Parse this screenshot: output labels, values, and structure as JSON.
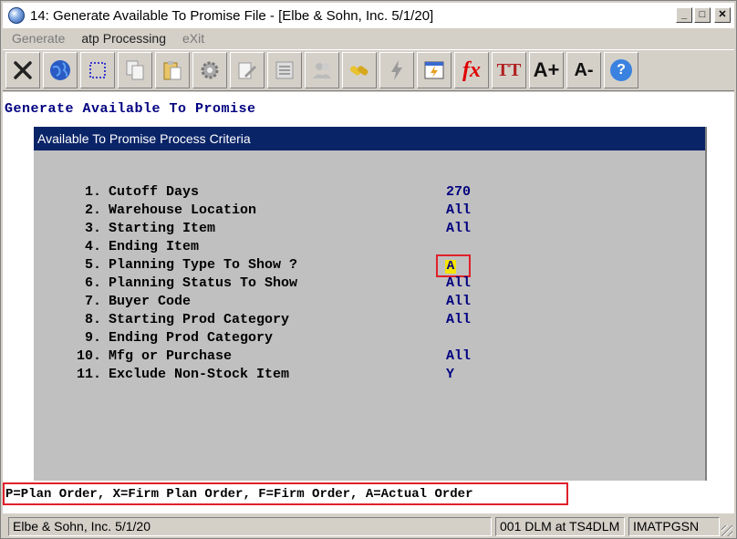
{
  "window": {
    "title": "14: Generate Available To Promise File - [Elbe & Sohn, Inc. 5/1/20]",
    "controls": [
      "_",
      "□",
      "✕"
    ]
  },
  "menu": [
    "Generate",
    "atp Processing",
    "eXit"
  ],
  "toolbar": [
    {
      "icon": "close-x-icon"
    },
    {
      "icon": "globe-icon"
    },
    {
      "icon": "select-box-icon"
    },
    {
      "icon": "copy-icon"
    },
    {
      "icon": "paste-icon"
    },
    {
      "icon": "gear-icon"
    },
    {
      "icon": "edit-icon"
    },
    {
      "icon": "list-icon"
    },
    {
      "icon": "users-icon"
    },
    {
      "icon": "link-icon"
    },
    {
      "icon": "lightning-icon"
    },
    {
      "icon": "calendar-icon"
    },
    {
      "icon": "function-icon",
      "text": "fx"
    },
    {
      "icon": "font-size-icon",
      "text": "TT"
    },
    {
      "icon": "font-increase-icon",
      "text": "A+"
    },
    {
      "icon": "font-decrease-icon",
      "text": "A-"
    },
    {
      "icon": "help-icon",
      "text": "?"
    }
  ],
  "page": {
    "heading": "Generate Available To Promise",
    "panel_title": "Available To Promise Process Criteria",
    "criteria": [
      {
        "num": "1.",
        "label": "Cutoff Days",
        "value": "270"
      },
      {
        "num": "2.",
        "label": "Warehouse Location",
        "value": "All"
      },
      {
        "num": "3.",
        "label": "Starting Item",
        "value": "All"
      },
      {
        "num": "4.",
        "label": "Ending Item",
        "value": ""
      },
      {
        "num": "5.",
        "label": "Planning Type To Show ?",
        "value": "A"
      },
      {
        "num": "6.",
        "label": "Planning Status To Show",
        "value": "All"
      },
      {
        "num": "7.",
        "label": "Buyer Code",
        "value": "All"
      },
      {
        "num": "8.",
        "label": "Starting Prod Category",
        "value": "All"
      },
      {
        "num": "9.",
        "label": "Ending Prod Category",
        "value": ""
      },
      {
        "num": "10.",
        "label": "Mfg or Purchase",
        "value": "All"
      },
      {
        "num": "11.",
        "label": "Exclude Non-Stock Item",
        "value": "Y"
      }
    ],
    "hint": "P=Plan Order, X=Firm Plan Order, F=Firm Order, A=Actual Order"
  },
  "status": {
    "company": "Elbe & Sohn, Inc. 5/1/20",
    "session": "001 DLM at TS4DLM",
    "program": "IMATPGSN"
  },
  "colors": {
    "heading": "#000080",
    "panel_header": "#0a2468",
    "highlight_border": "#e0202a",
    "cursor": "#f5e400"
  }
}
